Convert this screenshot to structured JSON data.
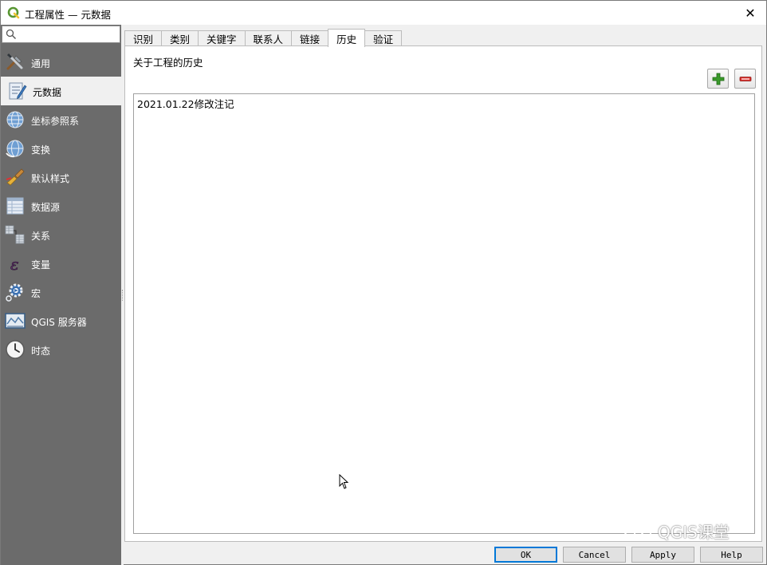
{
  "window": {
    "title": "工程属性 — 元数据",
    "close_glyph": "✕"
  },
  "sidebar": {
    "search_placeholder": "",
    "items": [
      {
        "label": "通用",
        "icon": "tools-icon"
      },
      {
        "label": "元数据",
        "icon": "metadata-icon",
        "active": true
      },
      {
        "label": "坐标参照系",
        "icon": "crs-globe-icon"
      },
      {
        "label": "变换",
        "icon": "transform-globe-icon"
      },
      {
        "label": "默认样式",
        "icon": "style-brush-icon"
      },
      {
        "label": "数据源",
        "icon": "datasource-table-icon"
      },
      {
        "label": "关系",
        "icon": "relations-icon"
      },
      {
        "label": "变量",
        "icon": "variable-icon"
      },
      {
        "label": "宏",
        "icon": "macro-gear-icon"
      },
      {
        "label": "QGIS 服务器",
        "icon": "server-map-icon"
      },
      {
        "label": "时态",
        "icon": "clock-icon"
      }
    ]
  },
  "tabs": [
    {
      "label": "识别"
    },
    {
      "label": "类别"
    },
    {
      "label": "关键字"
    },
    {
      "label": "联系人"
    },
    {
      "label": "链接"
    },
    {
      "label": "历史",
      "active": true
    },
    {
      "label": "验证"
    }
  ],
  "history": {
    "section_label": "关于工程的历史",
    "entry": "2021.01.22修改注记"
  },
  "buttons": {
    "ok": "OK",
    "cancel": "Cancel",
    "apply": "Apply",
    "help": "Help"
  },
  "watermark": {
    "text": "QGIS课堂"
  },
  "colors": {
    "sidebar_bg": "#6b6b6b",
    "add_green": "#3a9a2a",
    "remove_red": "#d9302c",
    "qgis_green": "#589632"
  }
}
